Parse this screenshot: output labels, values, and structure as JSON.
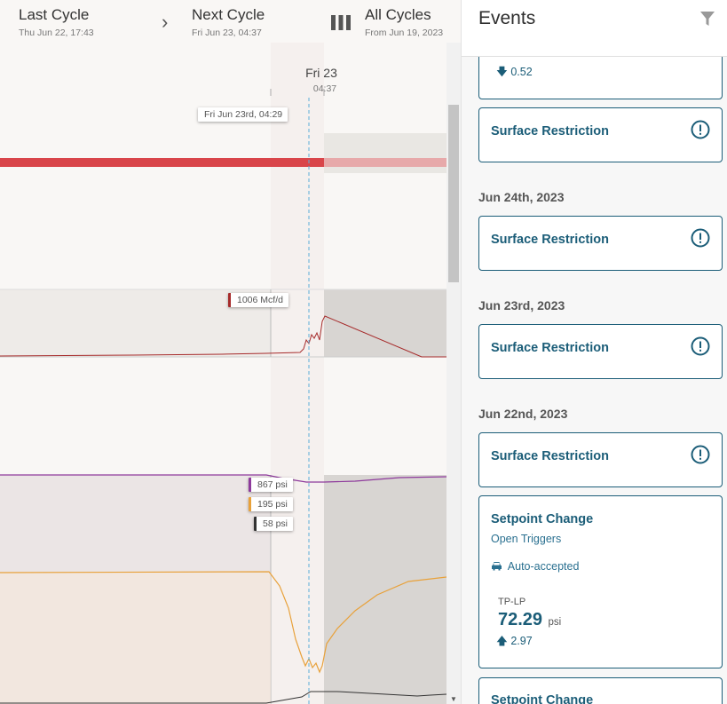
{
  "cycles": {
    "last": {
      "title": "Last Cycle",
      "sub": "Thu Jun 22, 17:43"
    },
    "next": {
      "title": "Next Cycle",
      "sub": "Fri Jun 23, 04:37"
    },
    "all": {
      "title": "All Cycles",
      "sub": "From Jun 19, 2023"
    }
  },
  "timeline": {
    "marker_day": "Fri 23",
    "marker_time": "04:37",
    "hover_label": "Fri Jun 23rd, 04:29"
  },
  "tags": {
    "flow": "1006 Mcf/d",
    "p1": "867 psi",
    "p2": "195 psi",
    "p3": "58 psi"
  },
  "colors": {
    "flow": "#a62a2a",
    "purple": "#8e3a9c",
    "orange": "#e8a13a",
    "dark": "#333333",
    "accent": "#1b5d78",
    "bar": "#d9454a",
    "dashed": "#5aaed8"
  },
  "events": {
    "title": "Events",
    "partial_top_value": "0.52",
    "cards": [
      {
        "title": "Surface Restriction"
      },
      {
        "title": "Surface Restriction"
      },
      {
        "title": "Surface Restriction"
      },
      {
        "title": "Surface Restriction"
      }
    ],
    "dates": [
      "Jun 24th, 2023",
      "Jun 23rd, 2023",
      "Jun 22nd, 2023"
    ],
    "setpoint": {
      "title": "Setpoint Change",
      "sub": "Open Triggers",
      "status": "Auto-accepted",
      "tag": "TP-LP",
      "value": "72.29",
      "unit": "psi",
      "delta": "2.97"
    },
    "next_title": "Setpoint Change"
  }
}
